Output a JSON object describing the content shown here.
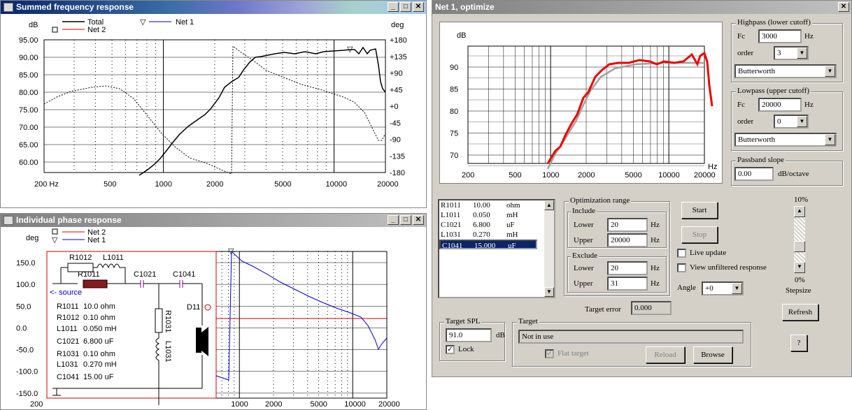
{
  "win1": {
    "title": "Summed frequency response",
    "ylabel_left": "dB",
    "ylabel_right": "deg",
    "legend": {
      "total": "Total",
      "net2": "Net 2",
      "net1": "Net 1"
    },
    "y_ticks": [
      "95.00",
      "90.00",
      "85.00",
      "80.00",
      "75.00",
      "70.00",
      "65.00",
      "60.00"
    ],
    "r_ticks": [
      "+180",
      "+135",
      "+90",
      "+45",
      "+0",
      "-45",
      "-90",
      "-135",
      "-180"
    ],
    "x_ticks": [
      "200 Hz",
      "500",
      "1000",
      "2000",
      "5000",
      "10000",
      "20000"
    ]
  },
  "win2": {
    "title": "Individual phase response",
    "ylabel": "deg",
    "legend": {
      "net2": "Net 2",
      "net1": "Net 1"
    },
    "y_ticks": [
      "150.0",
      "100.0",
      "50.0",
      "0.0",
      "-50.0",
      "-100.0",
      "-150.0"
    ],
    "x_ticks": [
      "200",
      "1000",
      "2000",
      "5000",
      "10000",
      "20000"
    ],
    "schematic": {
      "r1012": "R1012",
      "l1011": "L1011",
      "r1011": "R1011",
      "c1021": "C1021",
      "c1041": "C1041",
      "source": "<- source",
      "r1031": "R1031",
      "l1031": "L1031",
      "d11": "D11",
      "vals": [
        [
          "R1011",
          "10.0 ohm"
        ],
        [
          "R1012",
          "0.10 ohm"
        ],
        [
          "L1011",
          "0.050 mH"
        ],
        [
          "C1021",
          "6.800 uF"
        ],
        [
          "R1031",
          "0.10 ohm"
        ],
        [
          "L1031",
          "0.270 mH"
        ],
        [
          "C1041",
          "15.00 uF"
        ]
      ]
    }
  },
  "dlg": {
    "title": "Net 1, optimize",
    "chart": {
      "ylabel": "dB",
      "xunit": "Hz",
      "y_ticks": [
        "90",
        "85",
        "80",
        "75",
        "70"
      ],
      "x_ticks": [
        "200",
        "500",
        "1000",
        "2000",
        "5000",
        "10000",
        "20000"
      ]
    },
    "highpass": {
      "label": "Highpass (lower cutoff)",
      "fc_label": "Fc",
      "fc": "3000",
      "hz": "Hz",
      "order_label": "order",
      "order": "3",
      "type": "Butterworth"
    },
    "lowpass": {
      "label": "Lowpass (upper cutoff)",
      "fc_label": "Fc",
      "fc": "20000",
      "hz": "Hz",
      "order_label": "order",
      "order": "0",
      "type": "Butterworth"
    },
    "passband": {
      "label": "Passband slope",
      "value": "0.00",
      "unit": "dB/octave"
    },
    "components": [
      [
        "R1011",
        "10.00",
        "ohm"
      ],
      [
        "L1011",
        "0.050",
        "mH"
      ],
      [
        "C1021",
        "6.800",
        "uF"
      ],
      [
        "L1031",
        "0.270",
        "mH"
      ],
      [
        "C1041",
        "15.000",
        "uF"
      ]
    ],
    "selected_component": 4,
    "opt_range": {
      "label": "Optimization range",
      "include": "Include",
      "exclude": "Exclude",
      "lower": "Lower",
      "upper": "Upper",
      "hz": "Hz",
      "inc_lower": "20",
      "inc_upper": "20000",
      "exc_lower": "20",
      "exc_upper": "31"
    },
    "buttons": {
      "start": "Start",
      "stop": "Stop",
      "refresh": "Refresh",
      "help": "?",
      "reload": "Reload",
      "browse": "Browse"
    },
    "live_update": "Live update",
    "view_unfiltered": "View unfiltered response",
    "angle_label": "Angle",
    "angle": "+0",
    "stepsize": {
      "top": "10%",
      "bottom": "0%",
      "label": "Stepsize"
    },
    "target_error_label": "Target error",
    "target_error": "0.000",
    "target_spl": {
      "label": "Target SPL",
      "value": "91.0",
      "unit": "dB",
      "lock": "Lock"
    },
    "target": {
      "label": "Target",
      "value": "Not in use",
      "flat": "Flat target"
    }
  }
}
